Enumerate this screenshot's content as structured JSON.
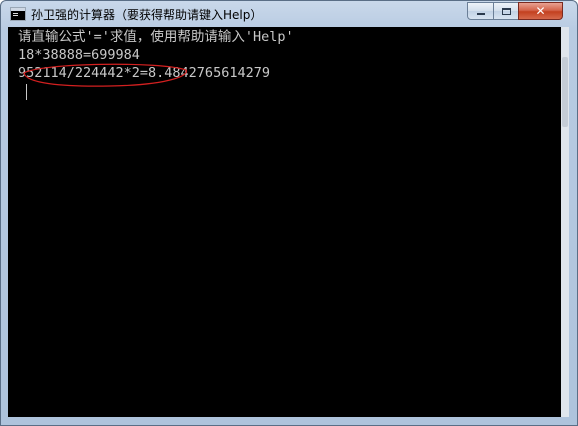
{
  "window": {
    "title": "孙卫强的计算器（要获得帮助请键入Help）"
  },
  "controls": {
    "minimize": "minimize",
    "maximize": "maximize",
    "close": "✕"
  },
  "console": {
    "lines": [
      "请直输公式'='求值，使用帮助请输入'Help'",
      "18*38888=699984",
      "952114/224442*2=8.4842765614279"
    ]
  },
  "colors": {
    "console_bg": "#000000",
    "console_text": "#c8c8c8",
    "annotation": "#d42020",
    "close_button": "#c3401f"
  }
}
